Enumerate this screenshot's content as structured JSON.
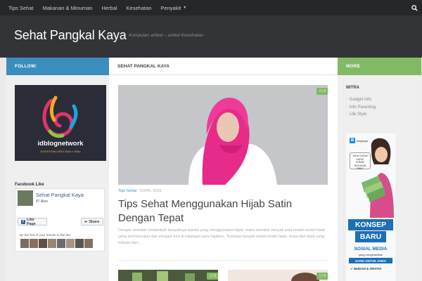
{
  "nav": {
    "items": [
      {
        "label": "Tips Sehat"
      },
      {
        "label": "Makanan & Minuman"
      },
      {
        "label": "Herbal"
      },
      {
        "label": "Kesehatan"
      },
      {
        "label": "Penyakit"
      }
    ],
    "search_icon": "search-icon"
  },
  "header": {
    "title": "Sehat Pangkal Kaya",
    "tagline": "Kumpulan artikel – artikel Kesehatan"
  },
  "sidebar_left": {
    "heading": "FOLLOW:",
    "ad": {
      "brand": "idblognetwork",
      "sub": "ADVERTISING AREA 300px x 250px"
    },
    "facebook": {
      "title": "Facebook Like",
      "page_name": "Sehat Pangkal Kaya",
      "likes": "87 likes",
      "like_label": "Like Page",
      "share_label": "Share",
      "friends_text": "Be the first of your friends to like this"
    }
  },
  "content": {
    "heading": "SEHAT PANGKAL KAYA",
    "post": {
      "comments": "0",
      "category": "Tips Sehat",
      "date": "3 APR, 2016",
      "title": "Tips Sehat Menggunakan Hijab Satin Dengan Tepat",
      "excerpt": "Dengan semakin bertambah banyaknya wanita yang menggunakan hijab, maka semakin banyak pula model-model hijab yang bermunculan dan menjadi tren di kalangan para hijabers. Terdapat banyak sekali model hijab, mulai dari hijab yang terbuat dari…"
    },
    "thumb1_comments": "0",
    "thumb2_comments": "0"
  },
  "sidebar_right": {
    "heading": "MORE",
    "mitra": {
      "title": "MITRA",
      "items": [
        "Gadget Info",
        "Info Parenting",
        "Life Style"
      ]
    },
    "banner": {
      "logo": "B",
      "name": "blogkaya",
      "bubble": "\"SAYA SUDAH DAPAT KOMISI RATUSAN RIBU\"",
      "line1": "KONSEP",
      "line2": "BARU",
      "line3": "SOSIAL MEDIA",
      "line4": "yang menghasilkan",
      "line5": "UANG UNTUK ANDA",
      "line6": "MUDAH & GRATIS"
    }
  },
  "colors": {
    "blue": "#3b8dbd",
    "green": "#82b965",
    "dark": "#26272b",
    "header": "#333438"
  }
}
